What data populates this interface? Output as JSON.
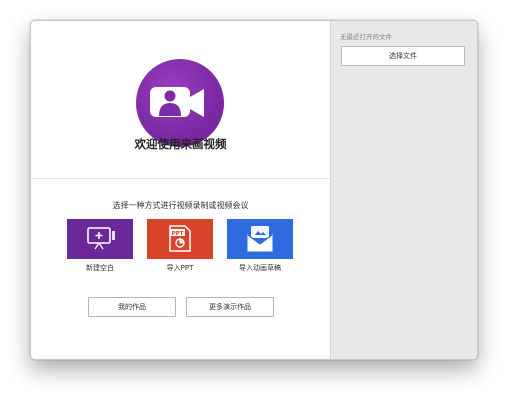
{
  "app": {
    "welcome_title": "欢迎使用来画视频",
    "logo_icon": "video-camera-person-icon",
    "brand_color": "#7d2ba6"
  },
  "main": {
    "subtitle": "选择一种方式进行视频录制或视频会议",
    "cards": [
      {
        "label": "新建空白",
        "icon": "blank-canvas-icon",
        "color": "#6a2898"
      },
      {
        "label": "导入PPT",
        "icon": "ppt-file-icon",
        "color": "#d9442b"
      },
      {
        "label": "导入动画草稿",
        "icon": "animation-draft-envelope-icon",
        "color": "#2f6be0"
      }
    ],
    "buttons": {
      "my_works": "我的作品",
      "more_demos": "更多演示作品"
    }
  },
  "sidebar": {
    "no_recent_label": "无最近打开的文件",
    "choose_file_label": "选择文件"
  }
}
